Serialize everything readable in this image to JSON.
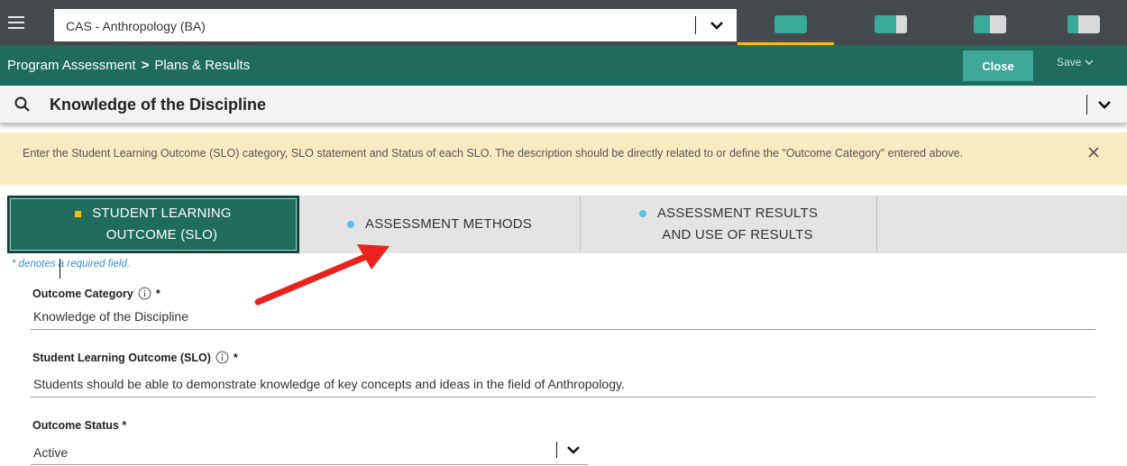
{
  "topbar": {
    "program": "CAS - Anthropology (BA)",
    "view_tabs": [
      {
        "icon": "layout-full-icon",
        "active": true
      },
      {
        "icon": "layout-right-panel-icon",
        "active": false
      },
      {
        "icon": "layout-split-icon",
        "active": false
      },
      {
        "icon": "layout-left-panel-icon",
        "active": false
      }
    ]
  },
  "breadcrumb": {
    "items": [
      "Program Assessment",
      "Plans & Results"
    ],
    "separator": ">"
  },
  "actions": {
    "close_label": "Close",
    "save_label": "Save"
  },
  "record": {
    "title": "Knowledge of the Discipline"
  },
  "banner": {
    "text": "Enter the Student Learning Outcome (SLO) category, SLO statement and Status of each SLO.  The description should be directly related to or define the \"Outcome Category\" entered above."
  },
  "tabs": [
    {
      "label_line1": "STUDENT LEARNING",
      "label_line2": "OUTCOME (SLO)",
      "active": true,
      "marker": "square"
    },
    {
      "label_line1": "ASSESSMENT METHODS",
      "label_line2": "",
      "active": false,
      "marker": "dot"
    },
    {
      "label_line1": "ASSESSMENT RESULTS",
      "label_line2": "AND USE OF RESULTS",
      "active": false,
      "marker": "dot"
    }
  ],
  "form": {
    "required_note": "* denotes a required field.",
    "outcome_category": {
      "label": "Outcome Category",
      "required": "*",
      "value": "Knowledge of the Discipline"
    },
    "slo": {
      "label": "Student Learning Outcome (SLO)",
      "required": "*",
      "value": "Students should be able to demonstrate knowledge of key concepts and ideas in the field of Anthropology."
    },
    "status": {
      "label": "Outcome Status *",
      "value": "Active"
    }
  },
  "colors": {
    "topbar": "#454a4f",
    "brand_green": "#1f6b5c",
    "accent_teal": "#3fa796",
    "active_indicator": "#f4c20d",
    "banner_bg": "#fcebc2",
    "annotation_arrow": "#e8231f"
  }
}
